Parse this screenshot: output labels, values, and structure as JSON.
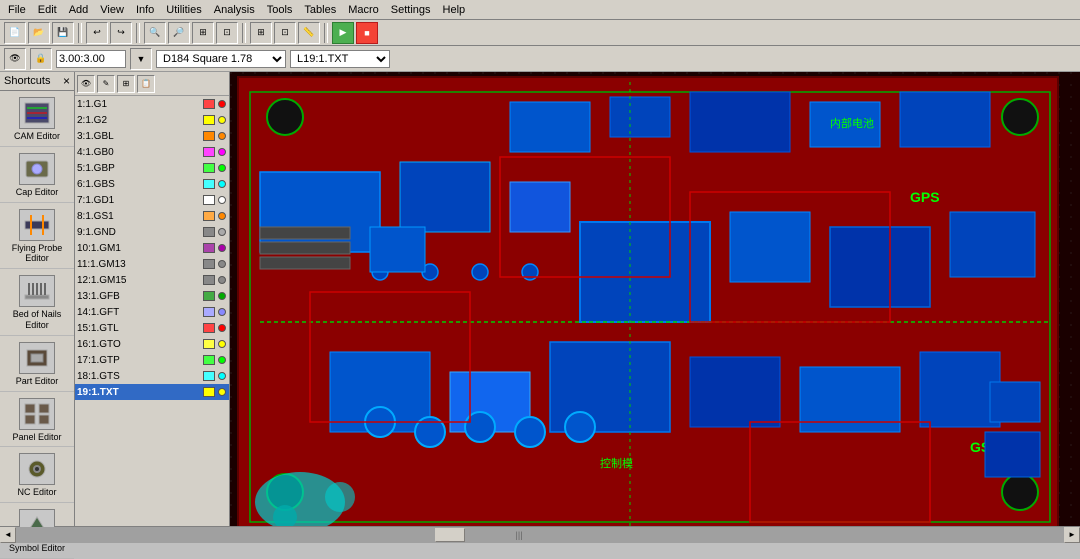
{
  "menubar": {
    "items": [
      "File",
      "Edit",
      "Add",
      "View",
      "Info",
      "Utilities",
      "Analysis",
      "Tools",
      "Tables",
      "Macro",
      "Settings",
      "Help"
    ]
  },
  "toolbar1": {
    "coord_label": "3.00:3.00",
    "tool_label": "D184  Square 1.78",
    "layer_label": "L19:1.TXT"
  },
  "shortcuts": {
    "title": "Shortcuts",
    "close_btn": "×",
    "items": [
      {
        "id": "cam-editor",
        "label": "CAM Editor"
      },
      {
        "id": "cap-editor",
        "label": "Cap Editor"
      },
      {
        "id": "flying-probe",
        "label": "Flying Probe Editor"
      },
      {
        "id": "bed-of-nails",
        "label": "Bed of Nails Editor"
      },
      {
        "id": "part-editor",
        "label": "Part Editor"
      },
      {
        "id": "panel-editor",
        "label": "Panel Editor"
      },
      {
        "id": "nc-editor",
        "label": "NC Editor"
      },
      {
        "id": "symbol-editor",
        "label": "Symbol Editor"
      }
    ]
  },
  "layers": {
    "items": [
      {
        "id": 1,
        "name": "1:1.G1",
        "color": "#ff0000",
        "dot": "#ff0000"
      },
      {
        "id": 2,
        "name": "2:1.G2",
        "color": "#ffff00",
        "dot": "#ffff00"
      },
      {
        "id": 3,
        "name": "3:1.GBL",
        "color": "#ffaa00",
        "dot": "#ffaa00"
      },
      {
        "id": 4,
        "name": "4:1.GB0",
        "color": "#ff00ff",
        "dot": "#ff00ff"
      },
      {
        "id": 5,
        "name": "5:1.GBP",
        "color": "#00ff00",
        "dot": "#00ff00"
      },
      {
        "id": 6,
        "name": "6:1.GBS",
        "color": "#00ffff",
        "dot": "#00ffff"
      },
      {
        "id": 7,
        "name": "7:1.GD1",
        "color": "#ffffff",
        "dot": "#ffffff"
      },
      {
        "id": 8,
        "name": "8:1.GS1",
        "color": "#ff8800",
        "dot": "#ff8800"
      },
      {
        "id": 9,
        "name": "9:1.GND",
        "color": "#888888",
        "dot": "#888888"
      },
      {
        "id": 10,
        "name": "10:1.GM1",
        "color": "#aa00aa",
        "dot": "#aa00aa"
      },
      {
        "id": 11,
        "name": "11:1.GM13",
        "color": "#888888",
        "dot": "#888888"
      },
      {
        "id": 12,
        "name": "12:1.GM15",
        "color": "#888888",
        "dot": "#888888"
      },
      {
        "id": 13,
        "name": "13:1.GFB",
        "color": "#00aa00",
        "dot": "#00aa00"
      },
      {
        "id": 14,
        "name": "14:1.GFT",
        "color": "#aaaaff",
        "dot": "#aaaaff"
      },
      {
        "id": 15,
        "name": "15:1.GTL",
        "color": "#ff0000",
        "dot": "#ff0000"
      },
      {
        "id": 16,
        "name": "16:1.GTO",
        "color": "#ffff00",
        "dot": "#ffff00"
      },
      {
        "id": 17,
        "name": "17:1.GTP",
        "color": "#00ff00",
        "dot": "#00ff00"
      },
      {
        "id": 18,
        "name": "18:1.GTS",
        "color": "#00ffff",
        "dot": "#00ffff"
      },
      {
        "id": 19,
        "name": "19:1.TXT",
        "color": "#ffff00",
        "dot": "#ffff00",
        "active": true
      }
    ]
  },
  "pcb": {
    "gps_label": "GPS",
    "gsm_label": "GSM",
    "battery_label": "内部电池",
    "control_label": "控制模"
  },
  "statusbar": {
    "scroll_hint": "|||"
  }
}
